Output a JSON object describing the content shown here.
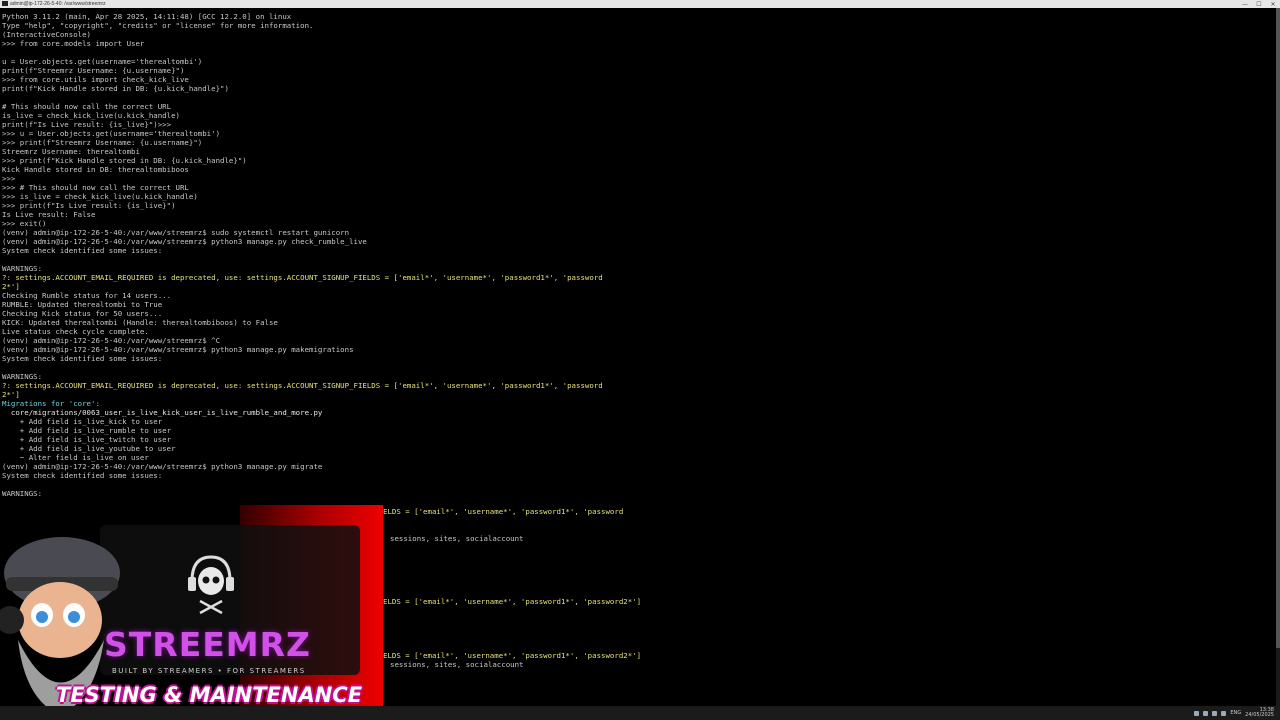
{
  "window": {
    "title": "admin@ip-172-26-5-40: /var/www/streemrz",
    "minimize_glyph": "—",
    "maximize_glyph": "☐",
    "close_glyph": "✕"
  },
  "terminal": {
    "lines": [
      {
        "text": "Python 3.11.2 (main, Apr 28 2025, 14:11:48) [GCC 12.2.0] on linux",
        "style": "plain"
      },
      {
        "text": "Type \"help\", \"copyright\", \"credits\" or \"license\" for more information.",
        "style": "plain"
      },
      {
        "text": "(InteractiveConsole)",
        "style": "plain"
      },
      {
        "text": ">>> from core.models import User",
        "style": "plain"
      },
      {
        "text": "",
        "style": "plain"
      },
      {
        "text": "u = User.objects.get(username='therealtombi')",
        "style": "plain"
      },
      {
        "text": "print(f\"Streemrz Username: {u.username}\")",
        "style": "plain"
      },
      {
        "text": ">>> from core.utils import check_kick_live",
        "style": "plain"
      },
      {
        "text": "print(f\"Kick Handle stored in DB: {u.kick_handle}\")",
        "style": "plain"
      },
      {
        "text": "",
        "style": "plain"
      },
      {
        "text": "# This should now call the correct URL",
        "style": "plain"
      },
      {
        "text": "is_live = check_kick_live(u.kick_handle)",
        "style": "plain"
      },
      {
        "text": "print(f\"Is Live result: {is_live}\")>>>",
        "style": "plain"
      },
      {
        "text": ">>> u = User.objects.get(username='therealtombi')",
        "style": "plain"
      },
      {
        "text": ">>> print(f\"Streemrz Username: {u.username}\")",
        "style": "plain"
      },
      {
        "text": "Streemrz Username: therealtombi",
        "style": "plain"
      },
      {
        "text": ">>> print(f\"Kick Handle stored in DB: {u.kick_handle}\")",
        "style": "plain"
      },
      {
        "text": "Kick Handle stored in DB: therealtombiboos",
        "style": "plain"
      },
      {
        "text": ">>>",
        "style": "plain"
      },
      {
        "text": ">>> # This should now call the correct URL",
        "style": "plain"
      },
      {
        "text": ">>> is_live = check_kick_live(u.kick_handle)",
        "style": "plain"
      },
      {
        "text": ">>> print(f\"Is Live result: {is_live}\")",
        "style": "plain"
      },
      {
        "text": "Is Live result: False",
        "style": "plain"
      },
      {
        "text": ">>> exit()",
        "style": "plain"
      },
      {
        "text": "(venv) admin@ip-172-26-5-40:/var/www/streemrz$ sudo systemctl restart gunicorn",
        "style": "plain"
      },
      {
        "text": "(venv) admin@ip-172-26-5-40:/var/www/streemrz$ python3 manage.py check_rumble_live",
        "style": "plain"
      },
      {
        "text": "System check identified some issues:",
        "style": "plain"
      },
      {
        "text": "",
        "style": "plain"
      },
      {
        "text": "WARNINGS:",
        "style": "plain"
      },
      {
        "text": "?: settings.ACCOUNT_EMAIL_REQUIRED is deprecated, use: settings.ACCOUNT_SIGNUP_FIELDS = ['email*', 'username*', 'password1*', 'password",
        "style": "yellow"
      },
      {
        "text": "2*']",
        "style": "yellow"
      },
      {
        "text": "Checking Rumble status for 14 users...",
        "style": "plain"
      },
      {
        "text": "RUMBLE: Updated therealtombi to True",
        "style": "plain"
      },
      {
        "text": "Checking Kick status for 50 users...",
        "style": "plain"
      },
      {
        "text": "KICK: Updated therealtombi (Handle: therealtombiboos) to False",
        "style": "plain"
      },
      {
        "text": "Live status check cycle complete.",
        "style": "plain"
      },
      {
        "text": "(venv) admin@ip-172-26-5-40:/var/www/streemrz$ ^C",
        "style": "plain"
      },
      {
        "text": "(venv) admin@ip-172-26-5-40:/var/www/streemrz$ python3 manage.py makemigrations",
        "style": "plain"
      },
      {
        "text": "System check identified some issues:",
        "style": "plain"
      },
      {
        "text": "",
        "style": "plain"
      },
      {
        "text": "WARNINGS:",
        "style": "plain"
      },
      {
        "text": "?: settings.ACCOUNT_EMAIL_REQUIRED is deprecated, use: settings.ACCOUNT_SIGNUP_FIELDS = ['email*', 'username*', 'password1*', 'password",
        "style": "yellow"
      },
      {
        "text": "2*']",
        "style": "yellow"
      },
      {
        "text": "Migrations for 'core':",
        "style": "cyan"
      },
      {
        "text": "  core/migrations/0063_user_is_live_kick_user_is_live_rumble_and_more.py",
        "style": "white"
      },
      {
        "text": "    + Add field is_live_kick to user",
        "style": "plain"
      },
      {
        "text": "    + Add field is_live_rumble to user",
        "style": "plain"
      },
      {
        "text": "    + Add field is_live_twitch to user",
        "style": "plain"
      },
      {
        "text": "    + Add field is_live_youtube to user",
        "style": "plain"
      },
      {
        "text": "    ~ Alter field is_live on user",
        "style": "plain"
      },
      {
        "text": "(venv) admin@ip-172-26-5-40:/var/www/streemrz$ python3 manage.py migrate",
        "style": "plain"
      },
      {
        "text": "System check identified some issues:",
        "style": "plain"
      },
      {
        "text": "",
        "style": "plain"
      },
      {
        "text": "WARNINGS:",
        "style": "plain"
      }
    ],
    "fragments": [
      {
        "text": "ELDS = ['email*', 'username*', 'password1*', 'password",
        "style": "yellow",
        "row": 55
      },
      {
        "text": "sessions, sites, socialaccount",
        "style": "plain",
        "row": 58
      },
      {
        "text": "ELDS = ['email*', 'username*', 'password1*', 'password2*']",
        "style": "yellow",
        "row": 65
      },
      {
        "text": "ELDS = ['email*', 'username*', 'password1*', 'password2*']",
        "style": "yellow",
        "row": 71
      },
      {
        "text": "sessions, sites, socialaccount",
        "style": "plain",
        "row": 72
      }
    ]
  },
  "overlay": {
    "brand": "STREEMRZ",
    "tagline": "BUILT BY STREAMERS • FOR STREAMERS",
    "banner": "TESTING & MAINTENANCE"
  },
  "taskbar": {
    "language": "ENG",
    "time": "13:38",
    "date": "24/05/2025"
  },
  "colors": {
    "terminal_bg": "#000000",
    "text": "#c8c8c8",
    "warning": "#e5e07a",
    "migration_header": "#6fd3e0",
    "brand": "#d050e8",
    "overlay_red": "#e00000"
  }
}
